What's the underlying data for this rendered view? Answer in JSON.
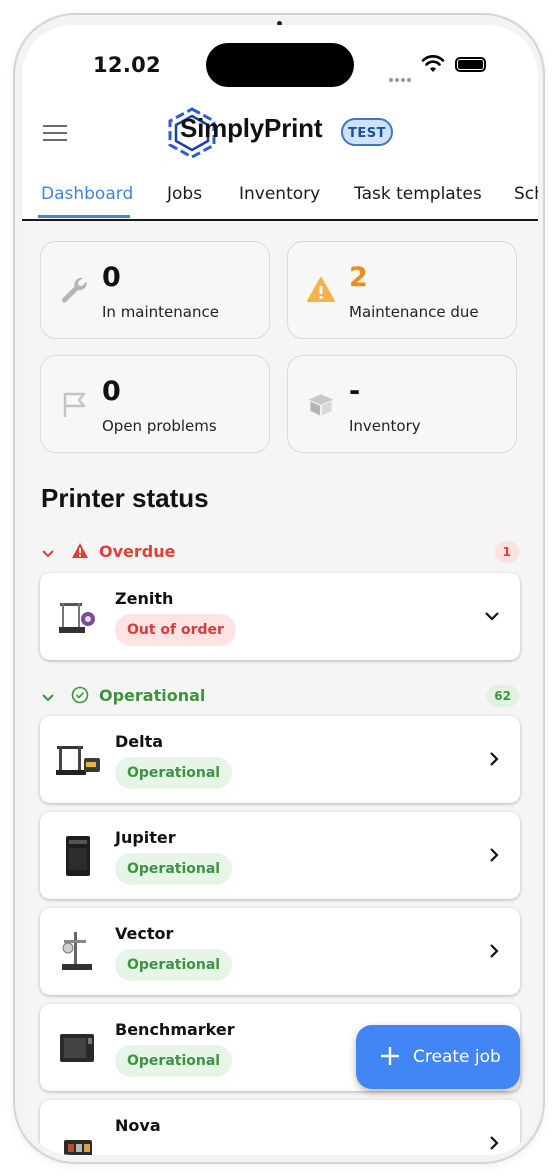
{
  "status_bar": {
    "time": "12.02"
  },
  "header": {
    "brand": "SimplyPrint",
    "badge": "TEST"
  },
  "tabs": [
    {
      "label": "Dashboard",
      "active": true
    },
    {
      "label": "Jobs"
    },
    {
      "label": "Inventory"
    },
    {
      "label": "Task templates"
    },
    {
      "label": "Sch"
    }
  ],
  "stats": [
    {
      "value": "0",
      "label": "In maintenance",
      "icon": "wrench-icon"
    },
    {
      "value": "2",
      "label": "Maintenance due",
      "icon": "warning-icon",
      "color": "#ee8a1a"
    },
    {
      "value": "0",
      "label": "Open problems",
      "icon": "flag-icon"
    },
    {
      "value": "-",
      "label": "Inventory",
      "icon": "box-icon"
    }
  ],
  "printer_status": {
    "title": "Printer status",
    "groups": [
      {
        "name": "Overdue",
        "count": "1",
        "color": "#e0403a",
        "printers": [
          {
            "name": "Zenith",
            "status": "Out of order",
            "expanded": true
          }
        ]
      },
      {
        "name": "Operational",
        "count": "62",
        "color": "#3a9440",
        "printers": [
          {
            "name": "Delta",
            "status": "Operational"
          },
          {
            "name": "Jupiter",
            "status": "Operational"
          },
          {
            "name": "Vector",
            "status": "Operational"
          },
          {
            "name": "Benchmarker",
            "status": "Operational"
          },
          {
            "name": "Nova",
            "status": ""
          }
        ]
      }
    ]
  },
  "fab": {
    "label": "Create job"
  }
}
